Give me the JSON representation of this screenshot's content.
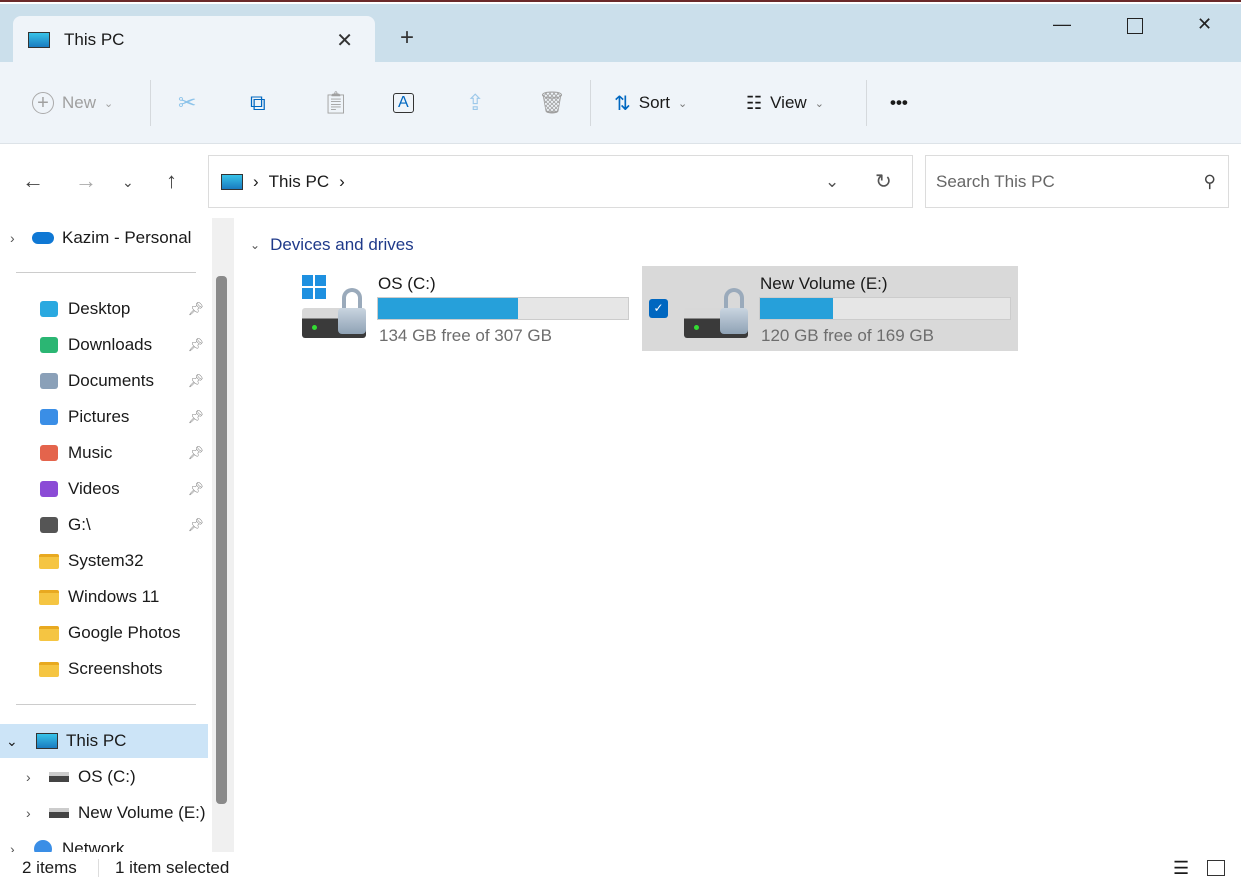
{
  "window": {
    "tab_title": "This PC",
    "icons": {
      "close": "close-icon",
      "new_tab": "plus-icon"
    }
  },
  "toolbar": {
    "new_label": "New",
    "sort_label": "Sort",
    "view_label": "View",
    "more": "•••"
  },
  "address": {
    "crumb": "This PC",
    "search_placeholder": "Search This PC"
  },
  "sidebar": {
    "cloud": "Kazim - Personal",
    "quick": [
      {
        "label": "Desktop",
        "icon": "desktop-icon",
        "color": "#2aa9e0"
      },
      {
        "label": "Downloads",
        "icon": "download-icon",
        "color": "#2bb673"
      },
      {
        "label": "Documents",
        "icon": "documents-icon",
        "color": "#8aa0b8"
      },
      {
        "label": "Pictures",
        "icon": "pictures-icon",
        "color": "#3a8ee6"
      },
      {
        "label": "Music",
        "icon": "music-icon",
        "color": "#e4644c"
      },
      {
        "label": "Videos",
        "icon": "videos-icon",
        "color": "#8b4bd6"
      },
      {
        "label": "G:\\",
        "icon": "drive-icon",
        "color": "#555"
      }
    ],
    "folders": [
      "System32",
      "Windows 11",
      "Google Photos",
      "Screenshots"
    ],
    "this_pc": "This PC",
    "drives": [
      "OS (C:)",
      "New Volume (E:)"
    ],
    "network": "Network"
  },
  "main": {
    "group": "Devices and drives",
    "drives": [
      {
        "name": "OS (C:)",
        "free": "134 GB free of 307 GB",
        "used_fraction": 0.56,
        "selected": false
      },
      {
        "name": "New Volume (E:)",
        "free": "120 GB free of 169 GB",
        "used_fraction": 0.29,
        "selected": true
      }
    ]
  },
  "status": {
    "items": "2 items",
    "selected": "1 item selected"
  }
}
